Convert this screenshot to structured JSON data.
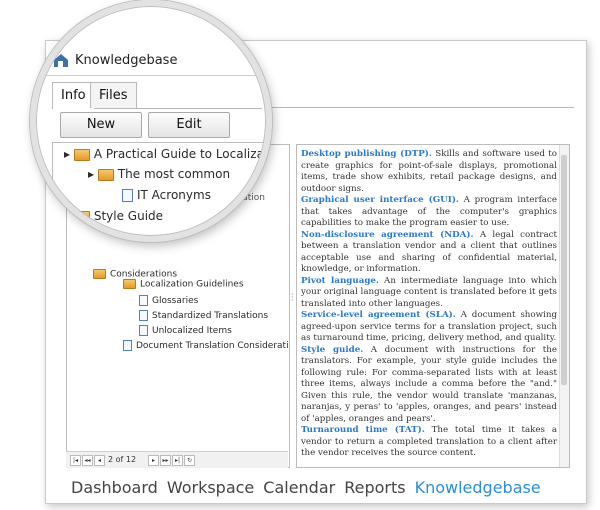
{
  "window": {
    "title": "Knowledgebase"
  },
  "tabs": [
    {
      "label": "Info"
    },
    {
      "label": "Files"
    }
  ],
  "buttons": {
    "new": "New",
    "edit": "Edit"
  },
  "tree": {
    "root": "A Practical Guide to Localization",
    "child": "The most common",
    "leaf": "IT Acronyms",
    "style_guide": "Style Guide",
    "considerations": "Considerations",
    "loc_guidelines": "Localization Guidelines",
    "glossaries": "Glossaries",
    "standardized": "Standardized Translations",
    "unlocalized": "Unlocalized Items",
    "doc_translation": "Document Translation Considerations"
  },
  "pager": {
    "text": "2 of 12"
  },
  "glossary": [
    {
      "term": "Desktop publishing (DTP).",
      "def": " Skills and software used to create graphics for point-of-sale displays, promotional items, trade show exhibits, retail package designs, and outdoor signs."
    },
    {
      "term": "Graphical user interface (GUI).",
      "def": " A program interface that takes advantage of the computer's graphics capabilities to make the program easier to use."
    },
    {
      "term": "Non-disclosure agreement (NDA).",
      "def": " A legal contract between a translation vendor and a client that outlines acceptable use and sharing of confidential material, knowledge, or information."
    },
    {
      "term": "Pivot language.",
      "def": " An intermediate language into which your original language content is translated before it gets translated into other languages."
    },
    {
      "term": "Service-level agreement (SLA).",
      "def": " A document showing agreed-upon service terms for a translation project, such as turnaround time, pricing, delivery method, and quality."
    },
    {
      "term": "Style guide.",
      "def": " A document with instructions for the translators. For example, your style guide includes the following rule: For comma-separated lists with at least three items, always include a comma before the \"and.\" Given this rule, the vendor would translate 'manzanas, naranjas, y peras' to 'apples, oranges, and pears' instead of 'apples, oranges and pears'."
    },
    {
      "term": "Turnaround time (TAT).",
      "def": " The total time it takes a vendor to return a completed translation to a client after the vendor receives the source content."
    }
  ],
  "nav": [
    {
      "label": "Dashboard"
    },
    {
      "label": "Workspace"
    },
    {
      "label": "Calendar"
    },
    {
      "label": "Reports"
    },
    {
      "label": "Knowledgebase"
    }
  ]
}
